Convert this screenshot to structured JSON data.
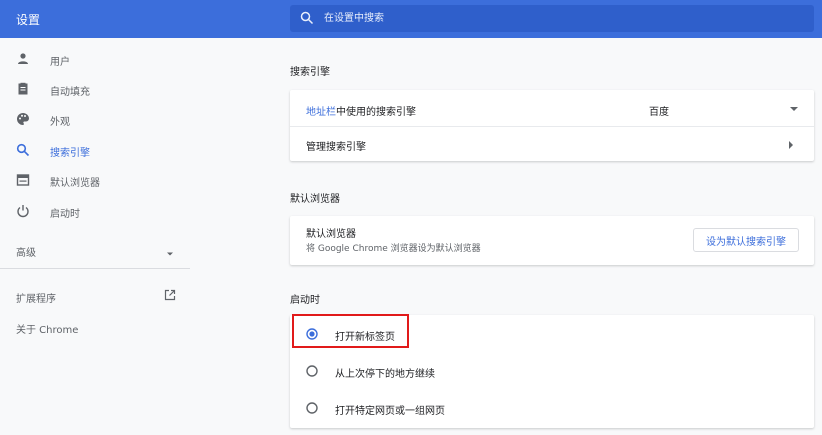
{
  "header": {
    "title": "设置",
    "search_placeholder": "在设置中搜索"
  },
  "sidebar": {
    "items": [
      {
        "label": "用户",
        "icon": "person-icon"
      },
      {
        "label": "自动填充",
        "icon": "clipboard-icon"
      },
      {
        "label": "外观",
        "icon": "palette-icon"
      },
      {
        "label": "搜索引擎",
        "icon": "search-icon"
      },
      {
        "label": "默认浏览器",
        "icon": "browser-icon"
      },
      {
        "label": "启动时",
        "icon": "power-icon"
      }
    ],
    "advanced": "高级",
    "extensions": "扩展程序",
    "about": "关于 Chrome",
    "active_item": "搜索引擎"
  },
  "search_engine": {
    "section_title": "搜索引擎",
    "address_bar_link": "地址栏",
    "address_bar_text": "中使用的搜索引擎",
    "selected_engine": "百度",
    "manage_label": "管理搜索引擎"
  },
  "default_browser": {
    "section_title": "默认浏览器",
    "label": "默认浏览器",
    "description": "将 Google Chrome 浏览器设为默认浏览器",
    "button_label": "设为默认搜索引擎"
  },
  "startup": {
    "section_title": "启动时",
    "options": [
      {
        "label": "打开新标签页",
        "selected": true
      },
      {
        "label": "从上次停下的地方继续",
        "selected": false
      },
      {
        "label": "打开特定网页或一组网页",
        "selected": false
      }
    ]
  },
  "colors": {
    "accent": "#3c6edb",
    "header": "#3c6edb",
    "highlight": "#e11a1a"
  }
}
